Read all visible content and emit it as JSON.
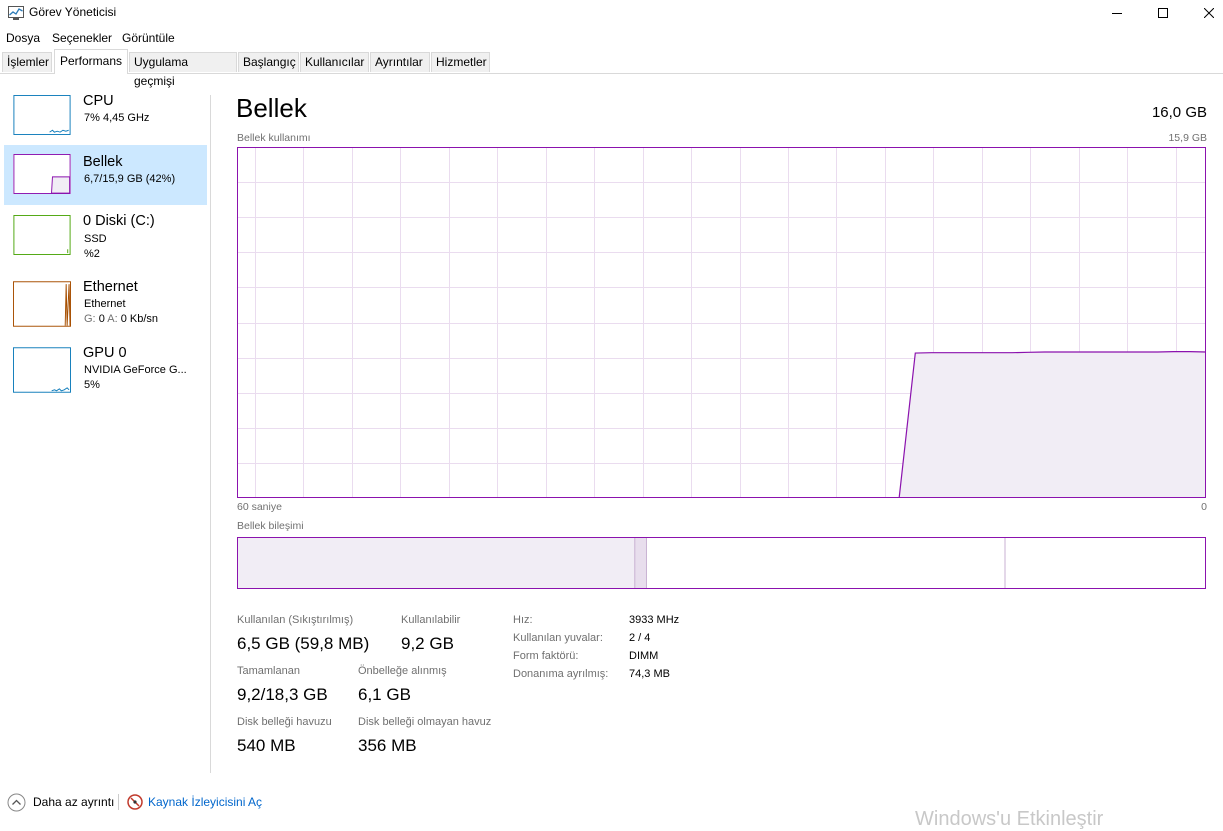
{
  "window": {
    "title": "Görev Yöneticisi",
    "min_icon": "minimize-icon",
    "max_icon": "maximize-icon",
    "close_icon": "close-icon"
  },
  "menu": [
    "Dosya",
    "Seçenekler",
    "Görüntüle"
  ],
  "tabs": [
    "İşlemler",
    "Performans",
    "Uygulama geçmişi",
    "Başlangıç",
    "Kullanıcılar",
    "Ayrıntılar",
    "Hizmetler"
  ],
  "active_tab": "Performans",
  "sidebar": [
    {
      "name": "CPU",
      "sub1": "7%  4,45 GHz",
      "color": "#117dbb"
    },
    {
      "name": "Bellek",
      "sub1": "6,7/15,9 GB (42%)",
      "color": "#8b12ae",
      "selected": true
    },
    {
      "name": "0 Diski (C:)",
      "sub1": "SSD",
      "sub2": "%2",
      "color": "#4da60c"
    },
    {
      "name": "Ethernet",
      "sub1": "Ethernet",
      "sub2_g": "G:",
      "sub2_gv": "0",
      "sub2_a": "A:",
      "sub2_av": "0 Kb/sn",
      "color": "#a74f01"
    },
    {
      "name": "GPU 0",
      "sub1": "NVIDIA GeForce G...",
      "sub2": "5%",
      "color": "#117dbb"
    }
  ],
  "main": {
    "title": "Bellek",
    "total": "16,0 GB",
    "usage_label": "Bellek kullanımı",
    "usage_max": "15,9 GB",
    "time_left": "60 saniye",
    "time_right": "0",
    "composition_label": "Bellek bileşimi",
    "usage_history_fraction": [
      0,
      0,
      0,
      0,
      0,
      0,
      0,
      0,
      0,
      0,
      0,
      0,
      0,
      0,
      0,
      0,
      0,
      0,
      0,
      0,
      0,
      0,
      0,
      0,
      0,
      0,
      0,
      0,
      0,
      0,
      0,
      0,
      0,
      0,
      0,
      0,
      0,
      0,
      0,
      0,
      0,
      0,
      0.413,
      0.414,
      0.414,
      0.414,
      0.414,
      0.414,
      0.414,
      0.415,
      0.416,
      0.416,
      0.416,
      0.416,
      0.416,
      0.416,
      0.416,
      0.416,
      0.417,
      0.417,
      0.416
    ],
    "composition": {
      "in_use_fraction": 0.41,
      "modified_fraction": 0.01,
      "standby_fraction": 0.37,
      "free_fraction": 0.21
    }
  },
  "stats": [
    {
      "label": "Kullanılan (Sıkıştırılmış)",
      "value": "6,5 GB (59,8 MB)"
    },
    {
      "label": "Kullanılabilir",
      "value": "9,2 GB"
    },
    {
      "label": "Tamamlanan",
      "value": "9,2/18,3 GB"
    },
    {
      "label": "Önbelleğe alınmış",
      "value": "6,1 GB"
    },
    {
      "label": "Disk belleği havuzu",
      "value": "540 MB"
    },
    {
      "label": "Disk belleği olmayan havuz",
      "value": "356 MB"
    }
  ],
  "details": [
    {
      "label": "Hız:",
      "value": "3933 MHz"
    },
    {
      "label": "Kullanılan yuvalar:",
      "value": "2 / 4"
    },
    {
      "label": "Form faktörü:",
      "value": "DIMM"
    },
    {
      "label": "Donanıma ayrılmış:",
      "value": "74,3 MB"
    }
  ],
  "footer": {
    "less_details": "Daha az ayrıntı",
    "resource_monitor": "Kaynak İzleyicisini Aç"
  },
  "watermark": "Windows'u Etkinleştir"
}
